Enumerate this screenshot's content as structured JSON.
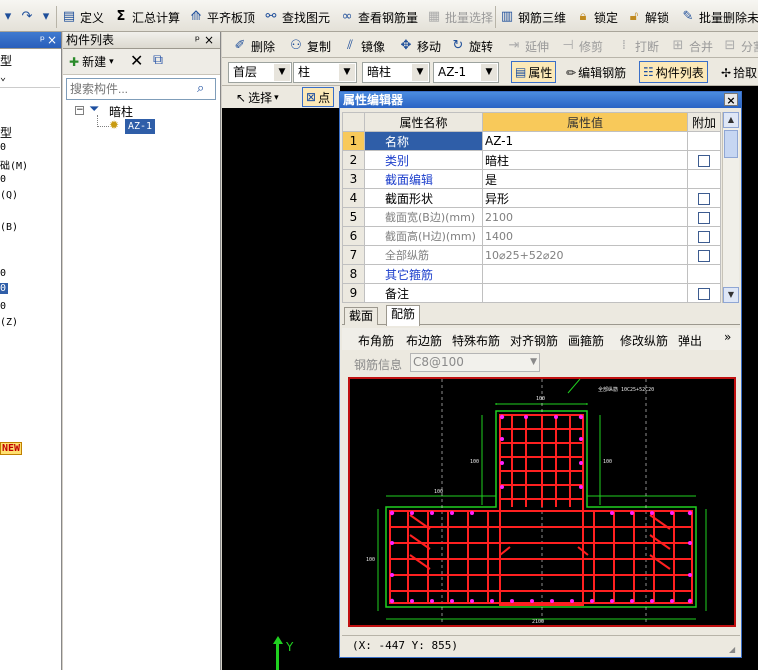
{
  "toolbar": {
    "items": [
      {
        "label": "定义",
        "icon": "define-icon"
      },
      {
        "label": "汇总计算",
        "icon": "sigma-icon"
      },
      {
        "label": "平齐板顶",
        "icon": "align-slab-icon"
      },
      {
        "label": "查找图元",
        "icon": "binoculars-icon"
      },
      {
        "label": "查看钢筋量",
        "icon": "glasses-icon"
      },
      {
        "label": "批量选择",
        "icon": "batch-select-icon"
      },
      {
        "label": "钢筋三维",
        "icon": "rebar-3d-icon"
      },
      {
        "label": "锁定",
        "icon": "lock-icon"
      },
      {
        "label": "解锁",
        "icon": "unlock-icon"
      },
      {
        "label": "批量删除未使",
        "icon": "batch-delete-icon"
      }
    ]
  },
  "left_panel": {
    "items": [
      "型",
      "0",
      "础(M)",
      "0",
      "(Q)",
      "(B)",
      "0",
      "0",
      "0",
      "(Z)"
    ],
    "badge": "NEW"
  },
  "component_list": {
    "title": "构件列表",
    "pin": "ᵖ",
    "close": "×",
    "new_label": "新建",
    "search_placeholder": "搜索构件...",
    "tree": {
      "root": "暗柱",
      "child": "AZ-1"
    }
  },
  "edit_toolbar": {
    "items": [
      "删除",
      "复制",
      "镜像",
      "移动",
      "旋转",
      "延伸",
      "修剪",
      "打断",
      "合并",
      "分割"
    ]
  },
  "selector_bar": {
    "floor": "首层",
    "category": "柱",
    "type": "暗柱",
    "component": "AZ-1",
    "buttons": [
      "属性",
      "编辑钢筋",
      "构件列表",
      "拾取"
    ]
  },
  "select_bar": {
    "select": "选择",
    "point": "点"
  },
  "property_editor": {
    "title": "属性编辑器",
    "headers": {
      "num": "",
      "name": "属性名称",
      "value": "属性值",
      "extra": "附加"
    },
    "rows": [
      {
        "num": "1",
        "name": "名称",
        "value": "AZ-1",
        "style": "sel",
        "check": false
      },
      {
        "num": "2",
        "name": "类别",
        "value": "暗柱",
        "style": "blue",
        "check": true
      },
      {
        "num": "3",
        "name": "截面编辑",
        "value": "是",
        "style": "blue",
        "check": false
      },
      {
        "num": "4",
        "name": "截面形状",
        "value": "异形",
        "style": "normal",
        "check": true
      },
      {
        "num": "5",
        "name": "截面宽(B边)(mm)",
        "value": "2100",
        "style": "grey",
        "check": true
      },
      {
        "num": "6",
        "name": "截面高(H边)(mm)",
        "value": "1400",
        "style": "grey",
        "check": true
      },
      {
        "num": "7",
        "name": "全部纵筋",
        "value": "10⌀25+52⌀20",
        "style": "grey",
        "check": true
      },
      {
        "num": "8",
        "name": "其它箍筋",
        "value": "",
        "style": "blue",
        "check": false
      },
      {
        "num": "9",
        "name": "备注",
        "value": "",
        "style": "normal",
        "check": true
      }
    ],
    "tabs": [
      "截面",
      "配筋"
    ],
    "rebar_buttons": [
      "布角筋",
      "布边筋",
      "特殊布筋",
      "对齐钢筋",
      "画箍筋",
      "修改纵筋",
      "弹出"
    ],
    "rebar_info_label": "钢筋信息",
    "rebar_info_value": "C8@100",
    "drawing_labels": {
      "top_width": "100",
      "mid_width": "100",
      "left_dim": "100",
      "right_dim": "100",
      "height_left": "100",
      "bottom_width": "2100",
      "note": "全部纵筋 10C25+52C20"
    },
    "status": "(X: -447 Y: 855)"
  },
  "canvas": {
    "axis_label": "Y"
  }
}
